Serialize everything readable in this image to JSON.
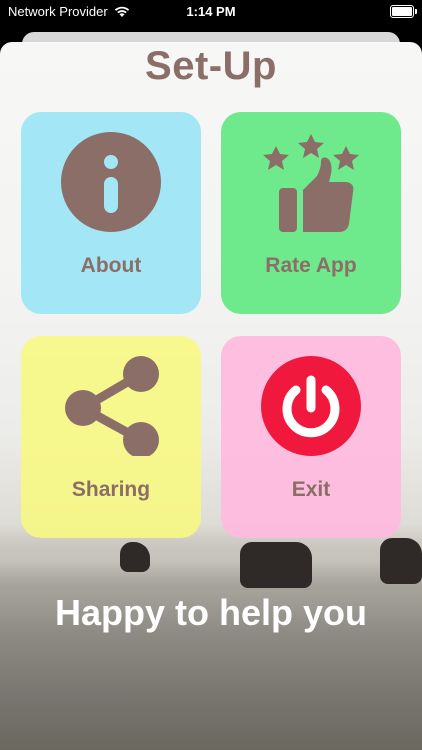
{
  "status_bar": {
    "carrier": "Network Provider",
    "time": "1:14 PM"
  },
  "screen": {
    "title": "Set-Up",
    "tiles": [
      {
        "label": "About",
        "icon": "info-icon",
        "color": "#a3e6f5"
      },
      {
        "label": "Rate App",
        "icon": "rate-stars-thumbs-up-icon",
        "color": "#6ee98b"
      },
      {
        "label": "Sharing",
        "icon": "share-icon",
        "color": "#f7f880"
      },
      {
        "label": "Exit",
        "icon": "power-icon",
        "color": "#ffbade"
      }
    ],
    "tagline": "Happy to help you"
  },
  "colors": {
    "accent_brown": "#8b6e68",
    "exit_red": "#f0183c"
  }
}
